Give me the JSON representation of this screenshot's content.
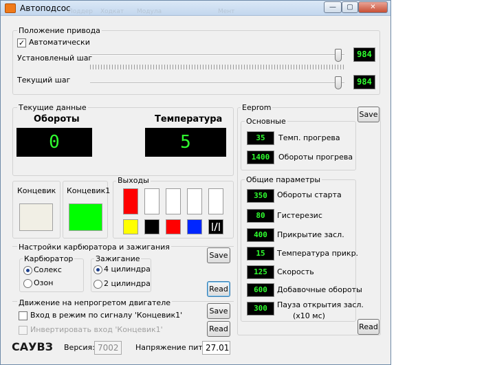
{
  "window": {
    "title": "Автоподсос",
    "ghost_menu": [
      "Поддер",
      "Ходкат",
      "Модула",
      "Мент"
    ],
    "controls": {
      "minimize": "—",
      "maximize": "▢",
      "close": "✕"
    }
  },
  "drive": {
    "group_title": "Положение привода",
    "auto_label": "Автоматически",
    "auto_checked": "✓",
    "set_step_label": "Установленый шаг",
    "set_step_value": "984",
    "set_step_fraction": 0.99,
    "cur_step_label": "Текущий шаг",
    "cur_step_value": "984",
    "cur_step_fraction": 0.99
  },
  "current": {
    "group_title": "Текущие данные",
    "rpm_label": "Обороты",
    "rpm_value": "0",
    "temp_label": "Температура",
    "temp_value": "5"
  },
  "limits": {
    "switch_label": "Концевик",
    "switch_color": "#f1efe5",
    "switch1_label": "Концевик1",
    "switch1_color": "#00ff00"
  },
  "outputs": {
    "group_title": "Выходы",
    "tall_colors": [
      "#ff0000",
      "#ffffff",
      "#ffffff",
      "#ffffff",
      "#ffffff"
    ],
    "small_colors": [
      "#ffff00",
      "#000000",
      "#ff0000",
      "#0026ff"
    ],
    "last_icon": "slash-icon"
  },
  "carb": {
    "group_title": "Настройки карбюратора и зажигания",
    "carb_title": "Карбюратор",
    "carb_options": [
      "Солекс",
      "Озон"
    ],
    "carb_selected": "Солекс",
    "ign_title": "Зажигание",
    "ign_options": [
      "4 цилиндра",
      "2 цилиндра"
    ],
    "ign_selected": "4 цилиндра",
    "save_label": "Save",
    "read_label": "Read"
  },
  "cold": {
    "group_title": "Движение на непрогретом двигателе",
    "enter_label": "Вход в режим по сигналу 'Концевик1'",
    "invert_label": "Инвертировать вход 'Концевик1'",
    "save_label": "Save",
    "read_label": "Read"
  },
  "eeprom": {
    "group_title": "Eeprom",
    "save_label": "Save",
    "read_label": "Read",
    "basic_title": "Основные",
    "basic": [
      {
        "value": "35",
        "label": "Темп. прогрева"
      },
      {
        "value": "1400",
        "label": "Обороты прогрева"
      }
    ],
    "common_title": "Общие параметры",
    "common": [
      {
        "value": "350",
        "label": "Обороты старта"
      },
      {
        "value": "80",
        "label": "Гистерезис"
      },
      {
        "value": "400",
        "label": "Прикрытие засл."
      },
      {
        "value": "15",
        "label": "Температура прикр."
      },
      {
        "value": "125",
        "label": "Скорость"
      },
      {
        "value": "600",
        "label": "Добавочные обороты"
      },
      {
        "value": "300",
        "label": "Пауза открытия засл.",
        "label2": "(x10 мс)"
      }
    ]
  },
  "footer": {
    "brand": "САУВЗ",
    "version_label": "Версия:",
    "version_value": "7002",
    "voltage_label": "Напряжение пит.:",
    "voltage_value": "27.01"
  }
}
